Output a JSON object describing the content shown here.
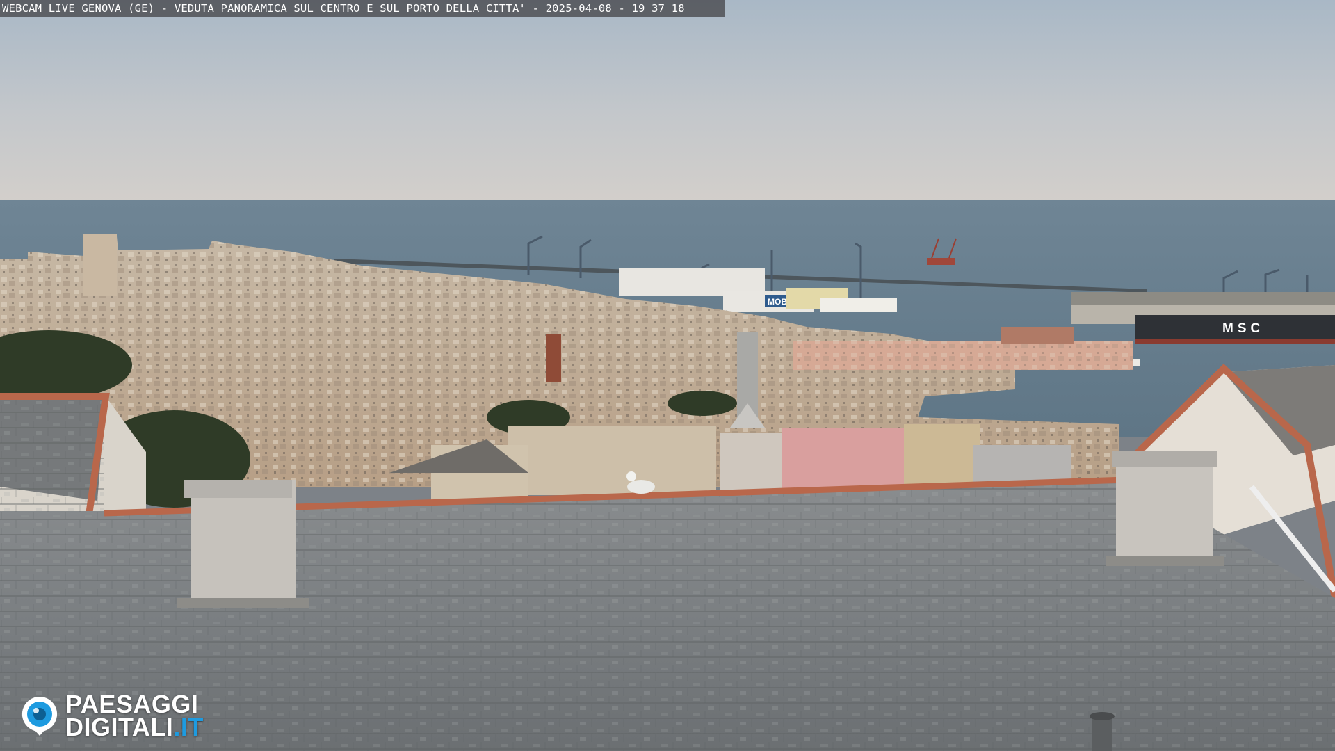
{
  "overlay": {
    "caption": "WEBCAM LIVE GENOVA (GE) - VEDUTA PANORAMICA SUL CENTRO E SUL PORTO DELLA CITTA' - 2025-04-08 - 19 37 18"
  },
  "watermark": {
    "line1": "PAESAGGI",
    "line2": "DIGITALI",
    "tld": ".IT",
    "icon": "camera-lens-icon",
    "accent_color": "#1e9be0"
  },
  "scene_labels": {
    "container_ship_hull": "MSC",
    "ferry_hull": "MOBY"
  }
}
